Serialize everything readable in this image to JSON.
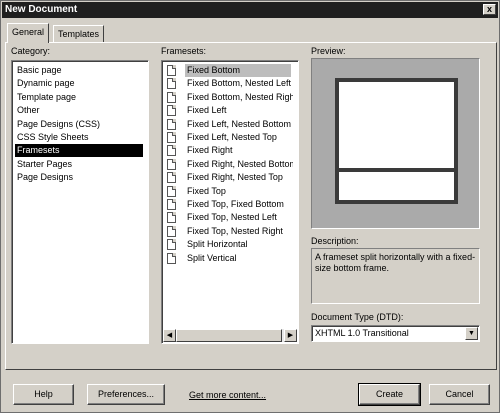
{
  "window": {
    "title": "New Document",
    "close_glyph": "x"
  },
  "tabs": [
    {
      "label": "General"
    },
    {
      "label": "Templates"
    }
  ],
  "category": {
    "label": "Category:",
    "items": [
      "Basic page",
      "Dynamic page",
      "Template page",
      "Other",
      "Page Designs (CSS)",
      "CSS Style Sheets",
      "Framesets",
      "Starter Pages",
      "Page Designs"
    ],
    "selected": "Framesets"
  },
  "framesets": {
    "label": "Framesets:",
    "items": [
      "Fixed Bottom",
      "Fixed Bottom, Nested Left",
      "Fixed Bottom, Nested Right",
      "Fixed Left",
      "Fixed Left, Nested Bottom",
      "Fixed Left, Nested Top",
      "Fixed Right",
      "Fixed Right, Nested Bottom",
      "Fixed Right, Nested Top",
      "Fixed Top",
      "Fixed Top, Fixed Bottom",
      "Fixed Top, Nested Left",
      "Fixed Top, Nested Right",
      "Split Horizontal",
      "Split Vertical"
    ],
    "selected": "Fixed Bottom"
  },
  "preview": {
    "label": "Preview:"
  },
  "description": {
    "label": "Description:",
    "text": "A frameset split horizontally with a fixed-size bottom frame."
  },
  "doctype": {
    "label": "Document Type (DTD):",
    "value": "XHTML 1.0 Transitional"
  },
  "footer": {
    "help": "Help",
    "preferences": "Preferences...",
    "more": "Get more content...",
    "create": "Create",
    "cancel": "Cancel"
  },
  "icons": {
    "scroll_left": "scroll-left-icon",
    "scroll_right": "scroll-right-icon",
    "dropdown": "chevron-down-icon",
    "document": "document-icon"
  }
}
